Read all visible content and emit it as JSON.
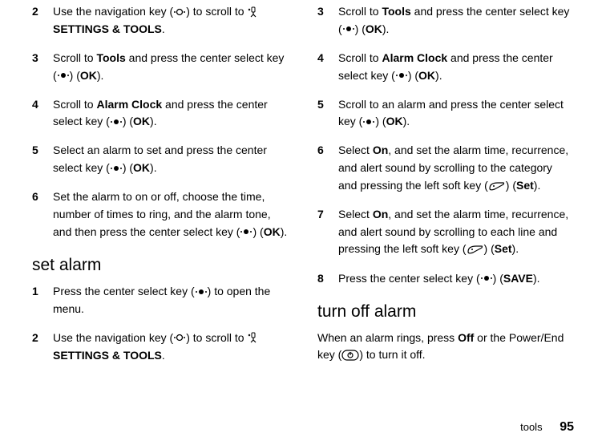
{
  "left": {
    "steps1": [
      {
        "num": "2",
        "parts": [
          {
            "t": "Use the navigation key ("
          },
          {
            "icon": "nav-open"
          },
          {
            "t": ") to scroll to "
          },
          {
            "icon": "settings-tools"
          },
          {
            "t": " "
          },
          {
            "cond": "SETTINGS & TOOLS"
          },
          {
            "t": "."
          }
        ]
      },
      {
        "num": "3",
        "parts": [
          {
            "t": "Scroll to "
          },
          {
            "cond": "Tools"
          },
          {
            "t": " and press the center select key ("
          },
          {
            "icon": "center-select"
          },
          {
            "t": ") ("
          },
          {
            "cond": "OK"
          },
          {
            "t": ")."
          }
        ]
      },
      {
        "num": "4",
        "parts": [
          {
            "t": "Scroll to "
          },
          {
            "cond": "Alarm Clock"
          },
          {
            "t": " and press the center select key ("
          },
          {
            "icon": "center-select"
          },
          {
            "t": ") ("
          },
          {
            "cond": "OK"
          },
          {
            "t": ")."
          }
        ]
      },
      {
        "num": "5",
        "parts": [
          {
            "t": "Select an alarm to set and press the center select key ("
          },
          {
            "icon": "center-select"
          },
          {
            "t": ") ("
          },
          {
            "cond": "OK"
          },
          {
            "t": ")."
          }
        ]
      },
      {
        "num": "6",
        "parts": [
          {
            "t": "Set the alarm to on or off, choose the time, number of times to ring, and the alarm tone, and then press the center select key ("
          },
          {
            "icon": "center-select"
          },
          {
            "t": ") ("
          },
          {
            "cond": "OK"
          },
          {
            "t": ")."
          }
        ]
      }
    ],
    "heading1": "set alarm",
    "steps2": [
      {
        "num": "1",
        "parts": [
          {
            "t": "Press the center select key ("
          },
          {
            "icon": "center-select"
          },
          {
            "t": ") to open the menu."
          }
        ]
      },
      {
        "num": "2",
        "parts": [
          {
            "t": "Use the navigation key ("
          },
          {
            "icon": "nav-open"
          },
          {
            "t": ") to scroll to "
          },
          {
            "icon": "settings-tools"
          },
          {
            "t": " "
          },
          {
            "cond": "SETTINGS & TOOLS"
          },
          {
            "t": "."
          }
        ]
      }
    ]
  },
  "right": {
    "steps1": [
      {
        "num": "3",
        "parts": [
          {
            "t": "Scroll to "
          },
          {
            "cond": "Tools"
          },
          {
            "t": " and press the center select key ("
          },
          {
            "icon": "center-select"
          },
          {
            "t": ") ("
          },
          {
            "cond": "OK"
          },
          {
            "t": ")."
          }
        ]
      },
      {
        "num": "4",
        "parts": [
          {
            "t": "Scroll to "
          },
          {
            "cond": "Alarm Clock"
          },
          {
            "t": " and press the center select key ("
          },
          {
            "icon": "center-select"
          },
          {
            "t": ") ("
          },
          {
            "cond": "OK"
          },
          {
            "t": ")."
          }
        ]
      },
      {
        "num": "5",
        "parts": [
          {
            "t": "Scroll to an alarm and press the center select key ("
          },
          {
            "icon": "center-select"
          },
          {
            "t": ") ("
          },
          {
            "cond": "OK"
          },
          {
            "t": ")."
          }
        ]
      },
      {
        "num": "6",
        "parts": [
          {
            "t": "Select "
          },
          {
            "cond": "On"
          },
          {
            "t": ", and set the alarm time, recurrence, and alert sound by scrolling to the category and pressing the left soft key ("
          },
          {
            "icon": "soft-key"
          },
          {
            "t": ") ("
          },
          {
            "cond": "Set"
          },
          {
            "t": ")."
          }
        ]
      },
      {
        "num": "7",
        "parts": [
          {
            "t": "Select "
          },
          {
            "cond": "On"
          },
          {
            "t": ", and set the alarm time, recurrence, and alert sound by scrolling to each line and pressing the left soft key ("
          },
          {
            "icon": "soft-key"
          },
          {
            "t": ") ("
          },
          {
            "cond": "Set"
          },
          {
            "t": ")."
          }
        ]
      },
      {
        "num": "8",
        "parts": [
          {
            "t": "Press the center select key ("
          },
          {
            "icon": "center-select"
          },
          {
            "t": ") ("
          },
          {
            "cond": "SAVE"
          },
          {
            "t": ")."
          }
        ]
      }
    ],
    "heading1": "turn off alarm",
    "para1": {
      "parts": [
        {
          "t": "When an alarm rings, press "
        },
        {
          "cond": "Off"
        },
        {
          "t": " or the Power/End key ("
        },
        {
          "icon": "power-end"
        },
        {
          "t": ") to turn it off."
        }
      ]
    }
  },
  "footer": {
    "section": "tools",
    "page": "95"
  }
}
